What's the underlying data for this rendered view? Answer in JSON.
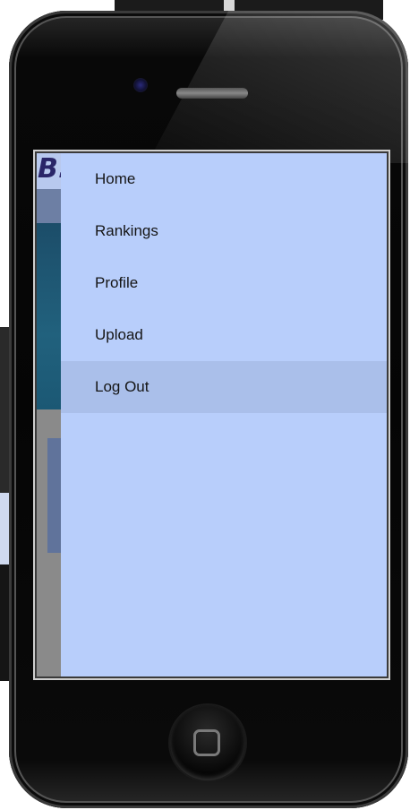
{
  "app": {
    "logo_text": "B."
  },
  "menu": {
    "items": [
      {
        "label": "Home",
        "active": false
      },
      {
        "label": "Rankings",
        "active": false
      },
      {
        "label": "Profile",
        "active": false
      },
      {
        "label": "Upload",
        "active": false
      },
      {
        "label": "Log Out",
        "active": true
      }
    ]
  },
  "colors": {
    "drawer_bg": "#b8cefb",
    "active_item_bg": "#aabfea",
    "phone_body": "#050505"
  }
}
